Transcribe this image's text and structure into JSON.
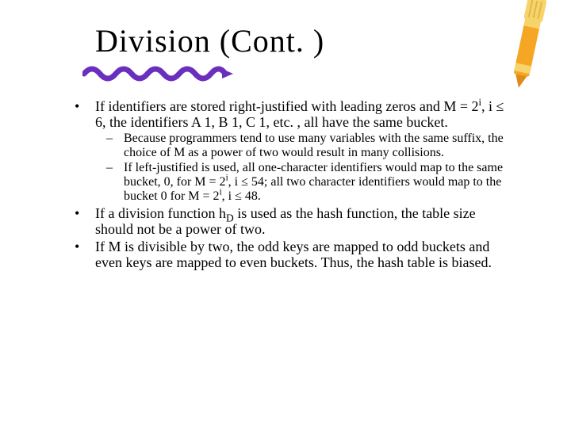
{
  "title": "Division (Cont. )",
  "bullets": [
    {
      "text_parts": [
        "If identifiers are stored right-justified  with leading zeros and M = 2",
        "i",
        ", i ≤ 6, the identifiers A 1, B 1, C 1, etc. , all have the same bucket."
      ],
      "sub": [
        "Because programmers tend to use many variables with the same suffix, the choice of M as a power of two would result in many collisions.",
        {
          "parts": [
            "If left-justified is used, all one-character identifiers would map to the same bucket, 0, for M = 2",
            "i",
            ", i ≤ 54; all two character identifiers would map to the bucket 0 for M = 2",
            "i",
            ", i ≤ 48."
          ]
        }
      ]
    },
    {
      "text_parts": [
        "If a division function h",
        "D",
        " is used as the hash function, the table size should not be a power of two."
      ]
    },
    {
      "text": "If M is divisible by two, the odd keys are mapped to odd buckets and even keys are mapped to even buckets. Thus, the hash table is biased."
    }
  ],
  "decor": {
    "crayon_color": "#f5a623",
    "crayon_wrap": "#f7d46a",
    "squiggle_color": "#6a2fbf"
  }
}
